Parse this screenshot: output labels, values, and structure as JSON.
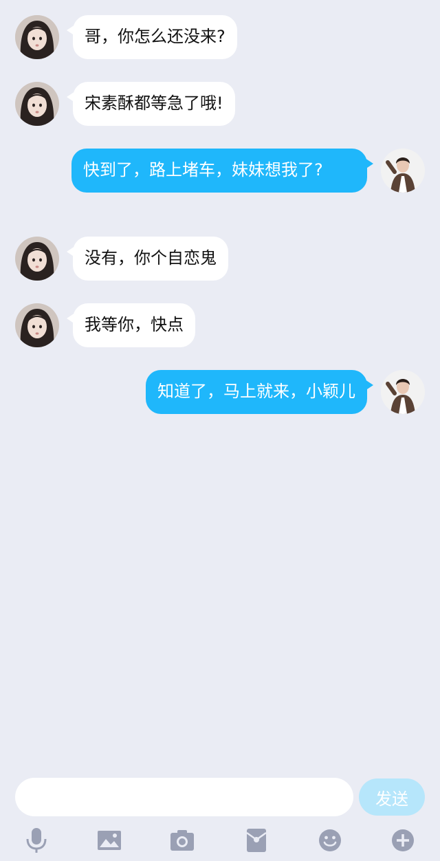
{
  "messages": [
    {
      "side": "left",
      "text": "哥，你怎么还没来?"
    },
    {
      "side": "left",
      "text": "宋素酥都等急了哦!"
    },
    {
      "side": "right",
      "text": "快到了，路上堵车，妹妹想我了?"
    },
    {
      "side": "left",
      "text": "没有，你个自恋鬼"
    },
    {
      "side": "left",
      "text": "我等你，快点"
    },
    {
      "side": "right",
      "text": "知道了，马上就来，小颖儿"
    }
  ],
  "composer": {
    "placeholder": "",
    "send_label": "发送"
  },
  "toolbar": {
    "icons": [
      "microphone-icon",
      "image-icon",
      "camera-icon",
      "red-packet-icon",
      "emoji-icon",
      "plus-icon"
    ]
  },
  "colors": {
    "background": "#eaecf4",
    "incoming_bubble": "#ffffff",
    "outgoing_bubble": "#1fb7fb",
    "send_button": "#b6e6fb",
    "toolbar_icon": "#9aa0b4"
  }
}
